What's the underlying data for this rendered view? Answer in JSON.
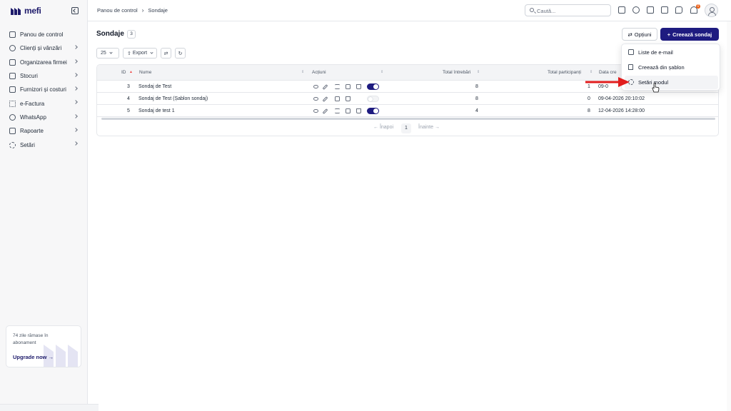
{
  "brand": {
    "name": "mefi",
    "color": "#1e1b6b"
  },
  "sidebar": {
    "items": [
      {
        "label": "Panou de control",
        "icon": "home-icon",
        "has_chevron": false
      },
      {
        "label": "Clienți și vânzări",
        "icon": "users-icon",
        "has_chevron": true
      },
      {
        "label": "Organizarea firmei",
        "icon": "org-icon",
        "has_chevron": true
      },
      {
        "label": "Stocuri",
        "icon": "archive-icon",
        "has_chevron": true
      },
      {
        "label": "Furnizori și costuri",
        "icon": "folder-icon",
        "has_chevron": true
      },
      {
        "label": "e-Factura",
        "icon": "efactura-icon",
        "has_chevron": true
      },
      {
        "label": "WhatsApp",
        "icon": "whatsapp-icon",
        "has_chevron": true
      },
      {
        "label": "Rapoarte",
        "icon": "clipboard-icon",
        "has_chevron": true
      },
      {
        "label": "Setări",
        "icon": "gear-icon",
        "has_chevron": true
      }
    ],
    "upgrade": {
      "text": "74 zile rămase în abonament",
      "link": "Upgrade now"
    }
  },
  "header": {
    "breadcrumb": [
      "Panou de control",
      "Sondaje"
    ],
    "search_placeholder": "Caută...",
    "notifications_count": "0",
    "icons": [
      "add-square-icon",
      "timer-icon",
      "calendar-icon",
      "check-square-icon",
      "chat-icon",
      "bell-icon"
    ]
  },
  "page": {
    "title": "Sondaje",
    "count": "3",
    "options_label": "Opțiuni",
    "create_label": "Creează sondaj",
    "accent": "#1e1b80"
  },
  "toolbar": {
    "page_size": "25",
    "export_label": "Export"
  },
  "table": {
    "columns": [
      "ID",
      "Nume",
      "Acțiuni",
      "Total întrebări",
      "Total participanți",
      "Data cre"
    ],
    "rows": [
      {
        "id": "3",
        "name": "Sondaj de Test",
        "active": true,
        "questions": "8",
        "participants": "1",
        "date": "09-0"
      },
      {
        "id": "4",
        "name": "Sondaj de Test (Șablon sondaj)",
        "active": false,
        "questions": "8",
        "participants": "0",
        "date": "09-04-2026 20:10:02"
      },
      {
        "id": "5",
        "name": "Sondaj de test 1",
        "active": true,
        "questions": "4",
        "participants": "8",
        "date": "12-04-2026 14:28:00"
      }
    ],
    "pagination": {
      "prev": "← Înapoi",
      "current": "1",
      "next": "Înainte →"
    }
  },
  "dropdown": {
    "items": [
      {
        "label": "Liste de e-mail",
        "icon": "mail-icon"
      },
      {
        "label": "Creează din șablon",
        "icon": "bookmark-icon"
      },
      {
        "label": "Setări modul",
        "icon": "gear-icon",
        "highlighted": true
      }
    ]
  },
  "colors": {
    "annotation_arrow": "#e11d1d",
    "notification": "#ea580c"
  }
}
